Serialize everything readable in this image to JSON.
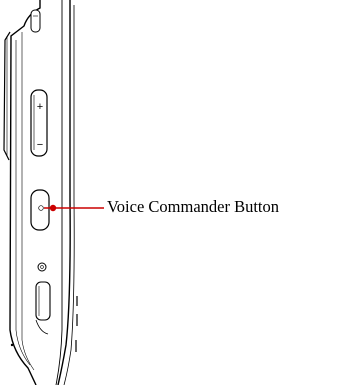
{
  "callout": {
    "label": "Voice Commander Button",
    "line_color": "#cc0000"
  },
  "device": {
    "outline_color": "#000000",
    "volume_up_symbol": "+",
    "volume_down_symbol": "−"
  }
}
